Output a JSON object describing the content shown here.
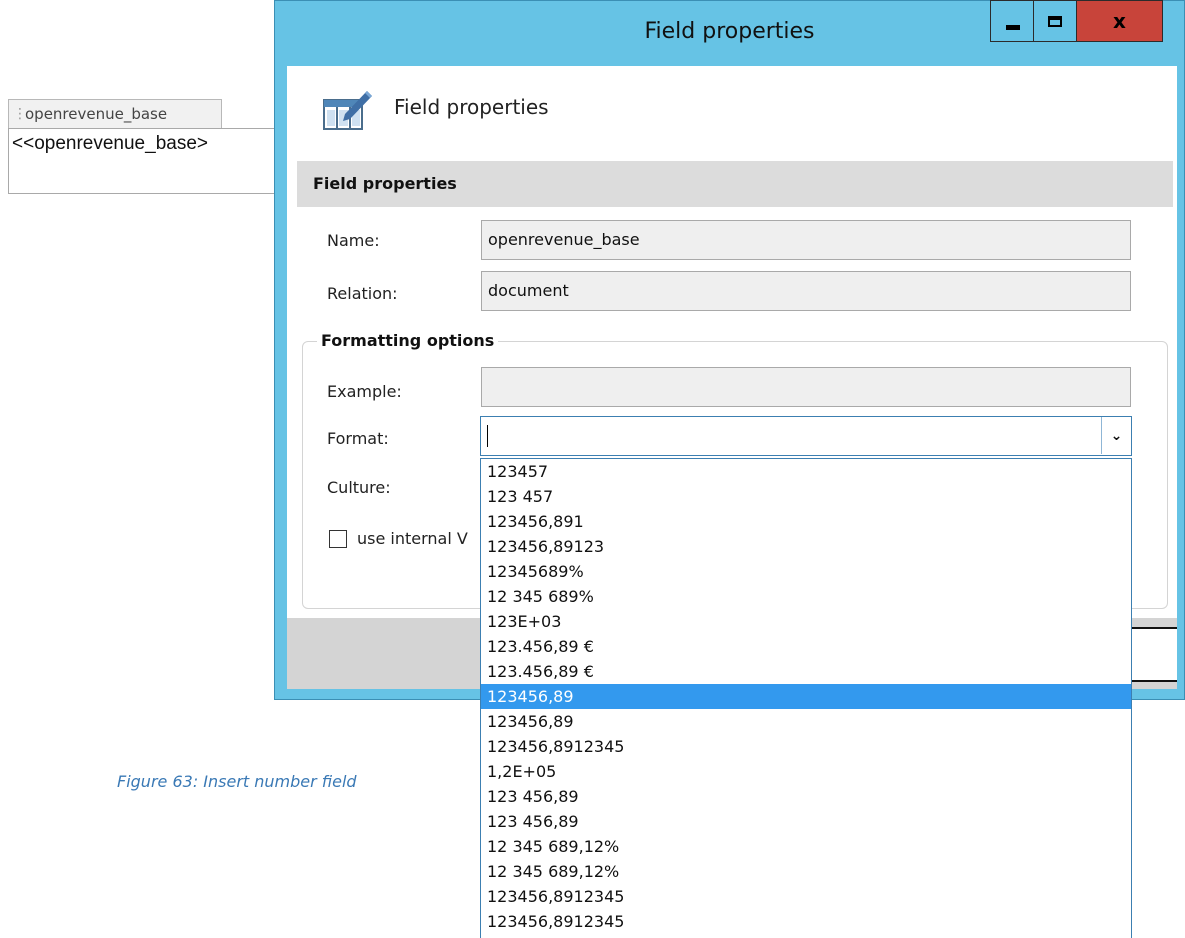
{
  "background": {
    "content_control_tag": "openrevenue_base",
    "content_control_text": "<<openrevenue_base>",
    "caption": "Figure 63: Insert number field"
  },
  "window": {
    "title": "Field properties",
    "controls": {
      "minimize": "minimize-icon",
      "maximize": "maximize-icon",
      "close": "x"
    }
  },
  "header": {
    "title": "Field properties",
    "icon": "table-edit-icon"
  },
  "section": {
    "title": "Field properties"
  },
  "fields": {
    "name_label": "Name:",
    "name_value": "openrevenue_base",
    "relation_label": "Relation:",
    "relation_value": "document"
  },
  "formatting": {
    "title": "Formatting options",
    "example_label": "Example:",
    "example_value": "",
    "format_label": "Format:",
    "format_value": "",
    "culture_label": "Culture:",
    "checkbox_label": "use internal V",
    "checkbox_checked": false
  },
  "dropdown": {
    "selected_index": 9,
    "options": [
      "123457",
      "123 457",
      "123456,891",
      "123456,89123",
      "12345689%",
      "12 345 689%",
      "123E+03",
      "123.456,89 €",
      "123.456,89 €",
      "123456,89",
      "123456,89",
      "123456,8912345",
      "1,2E+05",
      "123 456,89",
      "123 456,89",
      "12 345 689,12%",
      "12 345 689,12%",
      "123456,8912345",
      "123456,8912345"
    ]
  },
  "colors": {
    "title_bar": "#66c3e5",
    "close_button": "#c8443a",
    "selection": "#3399ee",
    "caption": "#3a79b5"
  }
}
